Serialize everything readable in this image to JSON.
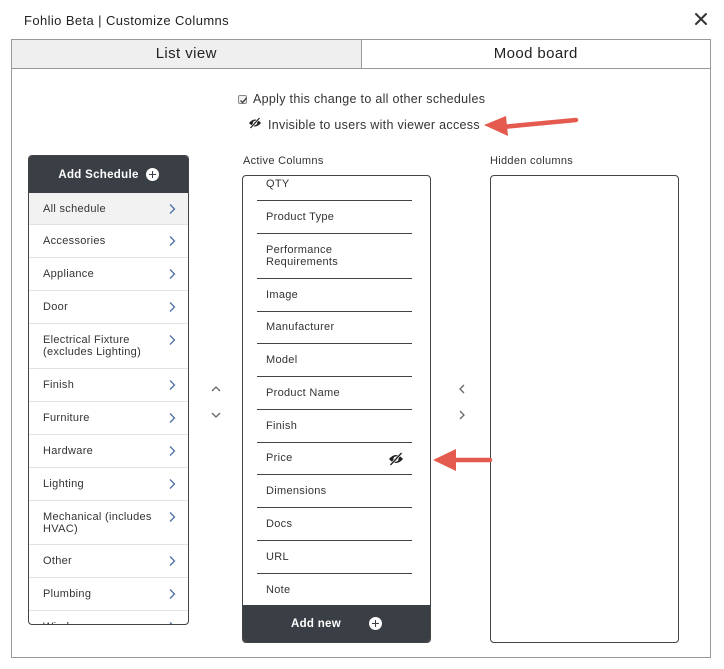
{
  "window": {
    "title": "Fohlio Beta | Customize Columns",
    "close_icon": "close-icon"
  },
  "tabs": [
    {
      "label": "List view",
      "active": true
    },
    {
      "label": "Mood board",
      "active": false
    }
  ],
  "options": {
    "apply_all_label": "Apply this change to all other schedules",
    "apply_all_checked": true,
    "invisible_label": "Invisible to users with viewer access",
    "invisible_icon": "eye-slash-icon"
  },
  "schedule": {
    "add_label": "Add Schedule",
    "items": [
      {
        "label": "All schedule",
        "active": true
      },
      {
        "label": "Accessories"
      },
      {
        "label": "Appliance"
      },
      {
        "label": "Door"
      },
      {
        "label": "Electrical Fixture (excludes Lighting)"
      },
      {
        "label": "Finish"
      },
      {
        "label": "Furniture"
      },
      {
        "label": "Hardware"
      },
      {
        "label": "Lighting"
      },
      {
        "label": "Mechanical (includes HVAC)"
      },
      {
        "label": "Other"
      },
      {
        "label": "Plumbing"
      },
      {
        "label": "Window"
      }
    ]
  },
  "active_columns": {
    "heading": "Active Columns",
    "items": [
      {
        "label": "QTY"
      },
      {
        "label": "Product Type"
      },
      {
        "label": "Performance Requirements"
      },
      {
        "label": "Image"
      },
      {
        "label": "Manufacturer"
      },
      {
        "label": "Model"
      },
      {
        "label": "Product Name"
      },
      {
        "label": "Finish"
      },
      {
        "label": "Price",
        "invisible": true
      },
      {
        "label": "Dimensions"
      },
      {
        "label": "Docs"
      },
      {
        "label": "URL"
      },
      {
        "label": "Note"
      }
    ],
    "add_label": "Add new"
  },
  "hidden_columns": {
    "heading": "Hidden columns",
    "items": []
  },
  "colors": {
    "dark_header": "#3a3f45",
    "annotation_arrow": "#e55a4e",
    "tab_active_bg": "#efefef"
  }
}
